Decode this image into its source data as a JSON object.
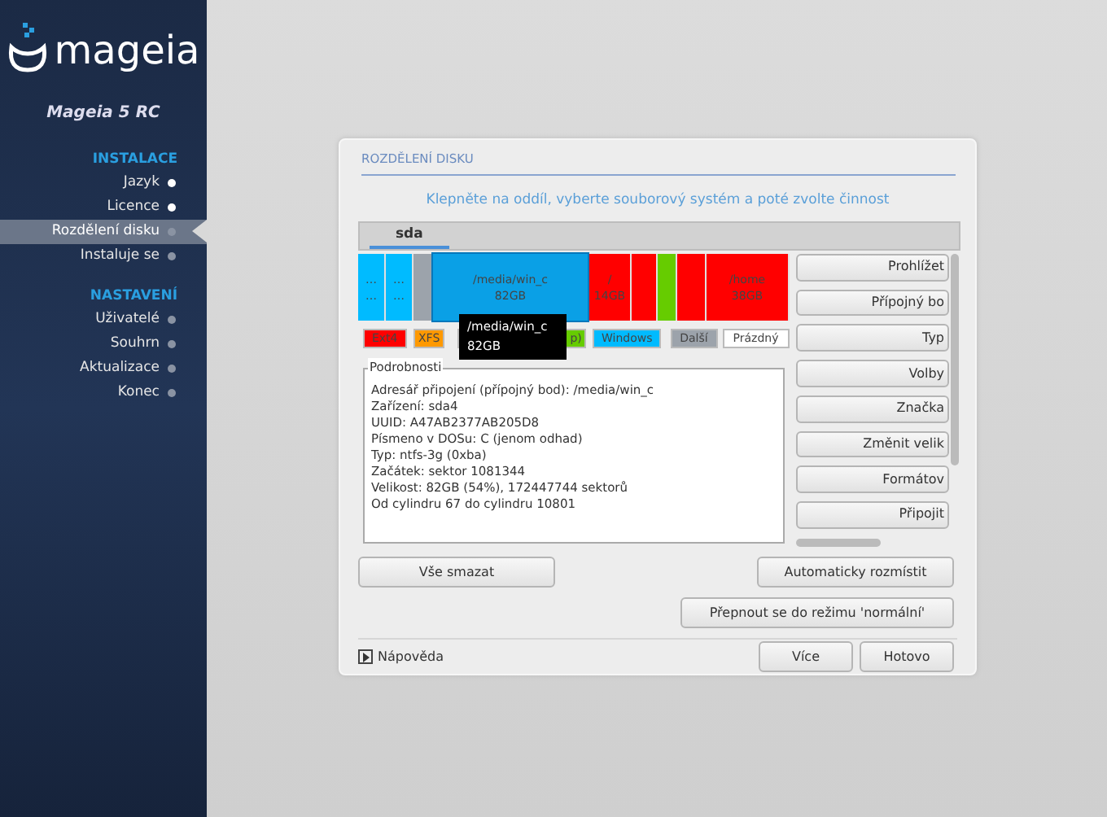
{
  "sidebar": {
    "logo": "mageia",
    "product": "Mageia 5 RC",
    "sections": [
      {
        "title": "INSTALACE",
        "items": [
          {
            "label": "Jazyk",
            "selected": false,
            "done": true
          },
          {
            "label": "Licence",
            "selected": false,
            "done": true
          },
          {
            "label": "Rozdělení disku",
            "selected": true,
            "done": false
          },
          {
            "label": "Instaluje se",
            "selected": false,
            "done": false
          }
        ]
      },
      {
        "title": "NASTAVENÍ",
        "items": [
          {
            "label": "Uživatelé",
            "selected": false,
            "done": false
          },
          {
            "label": "Souhrn",
            "selected": false,
            "done": false
          },
          {
            "label": "Aktualizace",
            "selected": false,
            "done": false
          },
          {
            "label": "Konec",
            "selected": false,
            "done": false
          }
        ]
      }
    ]
  },
  "dialog": {
    "title": "ROZDĚLENÍ DISKU",
    "instruction": "Klepněte na oddíl, vyberte souborový systém a poté zvolte činnost",
    "tabs": [
      {
        "label": "sda",
        "selected": true
      }
    ],
    "partitions": [
      {
        "lines": [
          "…",
          "…"
        ],
        "color": "#00bbff",
        "selected": false
      },
      {
        "lines": [
          "…",
          "…"
        ],
        "color": "#00bbff",
        "selected": false
      },
      {
        "color": "#9ca3ab",
        "selected": false
      },
      {
        "lines": [
          "/media/win_c",
          "82GB"
        ],
        "color": "#0aa0e6",
        "selected": true
      },
      {
        "lines": [
          "/",
          "14GB"
        ],
        "color": "#ff0000",
        "selected": false
      },
      {
        "color": "#ff0000",
        "selected": false
      },
      {
        "color": "#66cc00",
        "selected": false
      },
      {
        "color": "#ff0000",
        "selected": false
      },
      {
        "lines": [
          "/home",
          "38GB"
        ],
        "color": "#ff0000",
        "selected": false
      }
    ],
    "legend": [
      {
        "label": "Ext4",
        "color": "#ff0000"
      },
      {
        "label": "XFS",
        "color": "#ff9900"
      },
      {
        "label": "p)",
        "color": "#66cc00"
      },
      {
        "label": "Windows",
        "color": "#00bbff"
      },
      {
        "label": "Další",
        "color": "#9ca3ab"
      },
      {
        "label": "Prázdný",
        "color": "#ffffff"
      }
    ],
    "tooltip": [
      "/media/win_c",
      "82GB"
    ],
    "details": {
      "title": "Podrobnosti",
      "lines": [
        "Adresář připojení (přípojný bod): /media/win_c",
        "Zařízení: sda4",
        "UUID: A47AB2377AB205D8",
        "Písmeno v DOSu: C (jenom odhad)",
        "Typ: ntfs-3g (0xba)",
        "Začátek: sektor 1081344",
        "Velikost: 82GB (54%), 172447744 sektorů",
        "Od cylindru 67 do cylindru 10801"
      ]
    },
    "actions": [
      "Prohlížet",
      "Přípojný bo",
      "Typ",
      "Volby",
      "Značka",
      "Změnit velik",
      "Formátov",
      "Připojit"
    ],
    "clear_all": "Vše smazat",
    "auto_allocate": "Automaticky rozmístit",
    "normal_mode": "Přepnout se do režimu 'normální'",
    "help": "Nápověda",
    "more": "Více",
    "done": "Hotovo"
  }
}
